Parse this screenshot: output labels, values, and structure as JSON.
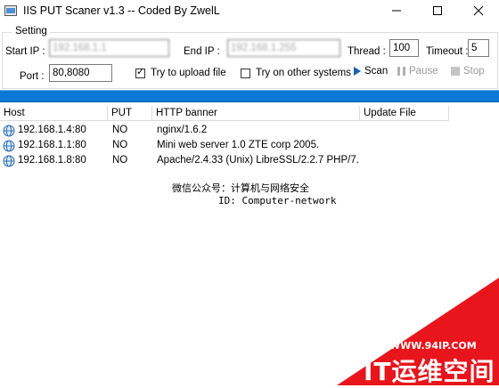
{
  "window": {
    "title": "IIS PUT Scaner v1.3 -- Coded By ZwelL"
  },
  "settings": {
    "legend": "Setting",
    "start_ip_label": "Start IP :",
    "start_ip_value": "192.168.1.1",
    "end_ip_label": "End IP :",
    "end_ip_value": "192.168.1.255",
    "thread_label": "Thread :",
    "thread_value": "100",
    "timeout_label": "Timeout :",
    "timeout_value": "5",
    "port_label": "Port :",
    "port_value": "80,8080",
    "upload_label": "Try to upload file",
    "upload_checked": true,
    "other_label": "Try on other systems",
    "other_checked": false
  },
  "toolbar": {
    "scan_label": "Scan",
    "pause_label": "Pause",
    "stop_label": "Stop"
  },
  "progress": {
    "fraction": 1.0,
    "color": "#0a78d7"
  },
  "table": {
    "columns": [
      "Host",
      "PUT",
      "HTTP banner",
      "Update File"
    ],
    "rows": [
      {
        "host": "192.168.1.4:80",
        "put": "NO",
        "banner": "nginx/1.6.2",
        "update": ""
      },
      {
        "host": "192.168.1.1:80",
        "put": "NO",
        "banner": "Mini web server 1.0 ZTE corp 2005.",
        "update": ""
      },
      {
        "host": "192.168.1.8:80",
        "put": "NO",
        "banner": "Apache/2.4.33 (Unix) LibreSSL/2.2.7 PHP/7...",
        "update": ""
      }
    ]
  },
  "watermark": {
    "line1": "微信公众号：计算机与网络安全",
    "line2": "ID: Computer-network",
    "site_url": "WWW.94IP.COM",
    "site_brand": "IT运维空间",
    "corner_color": "#e8161c"
  }
}
